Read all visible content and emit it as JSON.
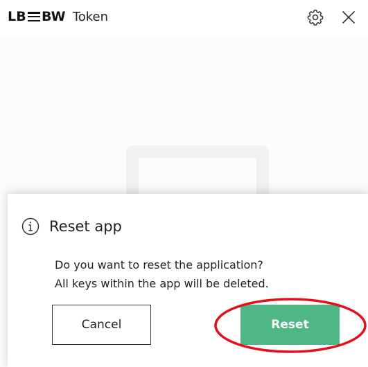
{
  "header": {
    "logo_left": "LB",
    "logo_right": "BW",
    "app_name": "Token",
    "settings_icon": "gear-icon",
    "close_icon": "close-icon"
  },
  "dialog": {
    "title": "Reset app",
    "info_icon": "info-icon",
    "message_line1": "Do you want to reset the application?",
    "message_line2": "All keys within the app will be deleted.",
    "cancel_label": "Cancel",
    "reset_label": "Reset"
  },
  "colors": {
    "accent_green": "#4fb784",
    "highlight_red": "#e3101a"
  }
}
